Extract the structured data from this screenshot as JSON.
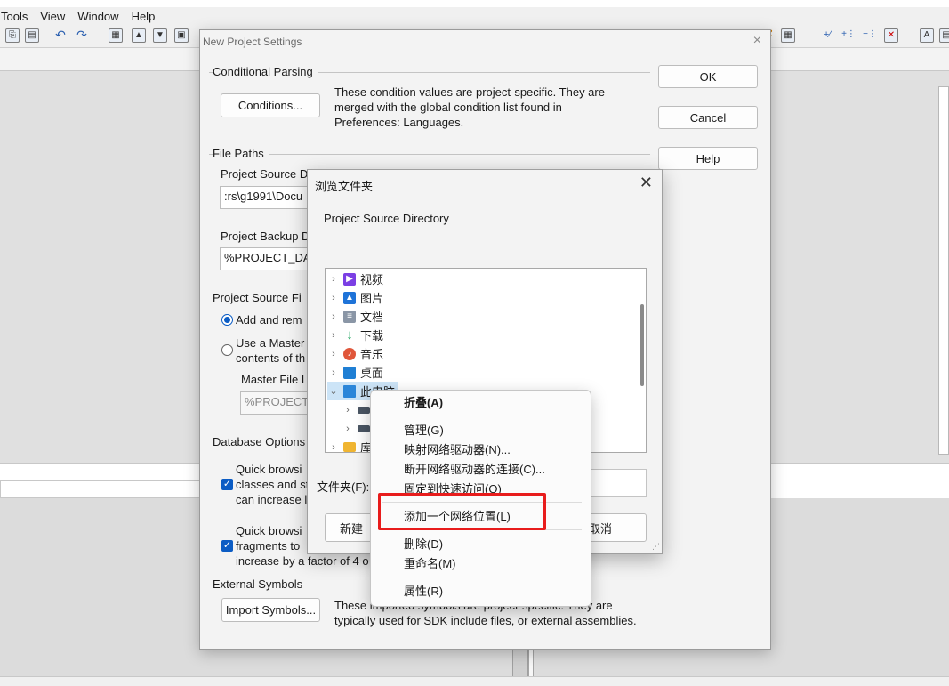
{
  "app": {
    "menu": [
      "Tools",
      "View",
      "Window",
      "Help"
    ]
  },
  "settings_dialog": {
    "title": "New Project Settings",
    "close_symbol": "×",
    "ok_label": "OK",
    "cancel_label": "Cancel",
    "help_label": "Help",
    "conditional_parsing": {
      "heading": "Conditional Parsing",
      "conditions_button": "Conditions...",
      "description_lines": [
        "These condition values are project-specific.  They are",
        "merged with the global condition list found in",
        "Preferences: Languages."
      ]
    },
    "file_paths": {
      "heading": "File Paths",
      "source_dir_label": "Project Source D",
      "source_dir_value": ":rs\\g1991\\Docu",
      "backup_label": "Project Backup D",
      "backup_value": "%PROJECT_DAT"
    },
    "source_files": {
      "heading": "Project Source Fi",
      "radio_add_label": "Add and rem",
      "radio_master_line1": "Use a Master",
      "radio_master_line2": "contents of th",
      "master_file_label": "Master File L",
      "master_file_value": "%PROJECT_"
    },
    "database": {
      "heading": "Database Options",
      "check1_lines": [
        "Quick browsi",
        "classes and st",
        "can increase l"
      ],
      "check2_lines": [
        "Quick browsi",
        "fragments to",
        "increase by a factor of 4 o"
      ]
    },
    "external_symbols": {
      "heading": "External Symbols",
      "import_button": "Import Symbols...",
      "description_lines": [
        "These imported symbols are project-specific. They are",
        "typically used for SDK include files, or external assemblies."
      ]
    }
  },
  "browse_dialog": {
    "title": "浏览文件夹",
    "close_symbol": "✕",
    "description": "Project Source Directory",
    "tree_items": [
      {
        "label": "视频",
        "icon": "video-icon",
        "color": "#7b3fe4"
      },
      {
        "label": "图片",
        "icon": "picture-icon",
        "color": "#1e73d8"
      },
      {
        "label": "文档",
        "icon": "document-icon",
        "color": "#8a96a6"
      },
      {
        "label": "下载",
        "icon": "download-icon",
        "color": "#1aa35b"
      },
      {
        "label": "音乐",
        "icon": "music-icon",
        "color": "#e0563a"
      },
      {
        "label": "桌面",
        "icon": "desktop-icon",
        "color": "#1f7fd4"
      },
      {
        "label": "此电脑",
        "icon": "computer-icon",
        "color": "#2b86d9"
      },
      {
        "label": "",
        "icon": "drive-icon",
        "color": "#4a5563"
      },
      {
        "label": "",
        "icon": "drive-icon",
        "color": "#4a5563"
      },
      {
        "label": "库",
        "icon": "library-folder-icon",
        "color": "#f0b531"
      }
    ],
    "folder_label": "文件夹(F):",
    "new_folder_button": "新建",
    "cancel_button": "取消"
  },
  "context_menu": {
    "items": [
      {
        "label": "折叠(A)",
        "bold": true
      },
      {
        "label": "管理(G)"
      },
      {
        "label": "映射网络驱动器(N)..."
      },
      {
        "label": "断开网络驱动器的连接(C)..."
      },
      {
        "label": "固定到快速访问(Q)"
      },
      {
        "label": "添加一个网络位置(L)"
      },
      {
        "label": "删除(D)"
      },
      {
        "label": "重命名(M)"
      },
      {
        "label": "属性(R)"
      }
    ]
  },
  "colors": {
    "accent": "#0b5cc4",
    "annotation": "#e81c1c"
  }
}
